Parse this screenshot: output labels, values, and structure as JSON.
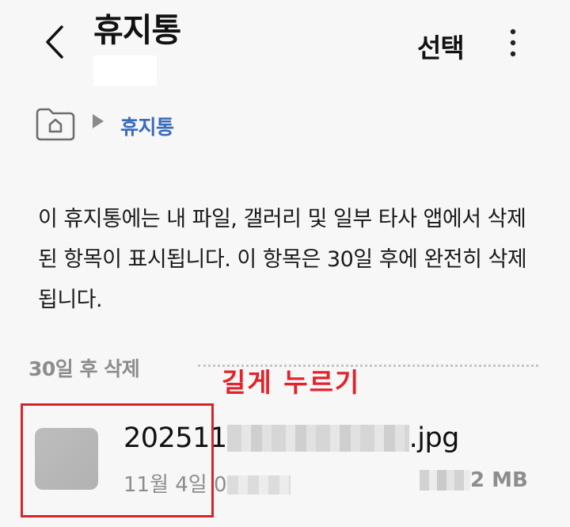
{
  "header": {
    "title": "휴지통",
    "select_label": "선택"
  },
  "breadcrumb": {
    "current": "휴지통"
  },
  "info_text": "이 휴지통에는 내 파일, 갤러리 및 일부 타사 앱에서 삭제된 항목이 표시됩니다. 이 항목은 30일 후에 완전히 삭제됩니다.",
  "section": {
    "label": "30일 후 삭제"
  },
  "annotation": {
    "text": "길게 누르기",
    "color": "#e2232a"
  },
  "file": {
    "name_prefix": "202511",
    "name_suffix": ".jpg",
    "date_prefix": "11월 4일 0",
    "size_suffix": "2 MB"
  },
  "colors": {
    "background": "#f7f7f7",
    "breadcrumb_accent": "#3a6bbd",
    "annotation_red": "#d9232a"
  }
}
